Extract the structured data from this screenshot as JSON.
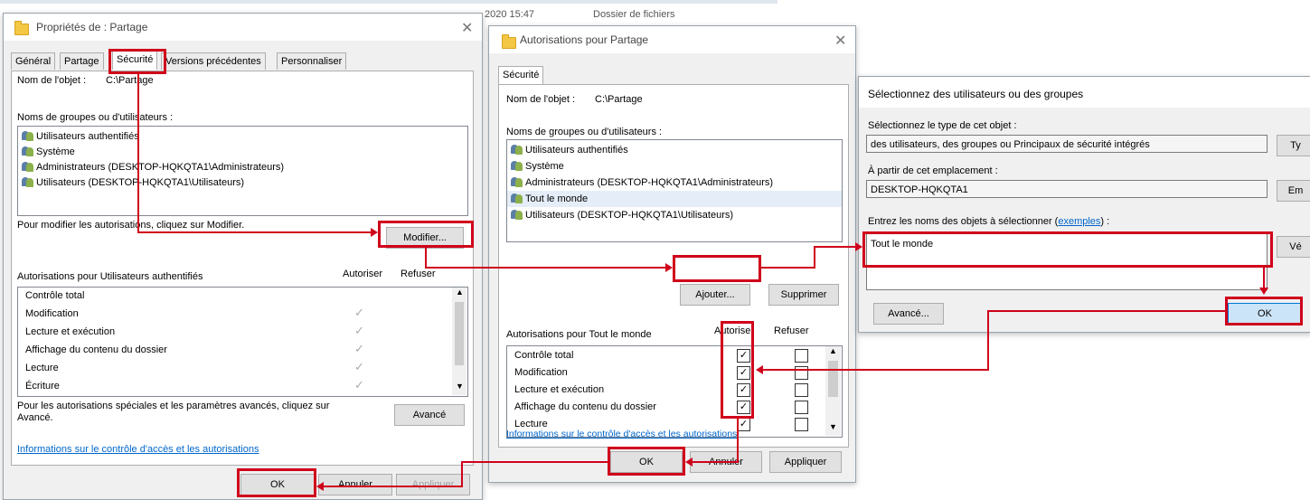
{
  "bg_header": {
    "date": "2020 15:47",
    "type": "Dossier de fichiers"
  },
  "win1": {
    "title": "Propriétés de : Partage",
    "tabs": [
      "Général",
      "Partage",
      "Sécurité",
      "Versions précédentes",
      "Personnaliser"
    ],
    "object_label": "Nom de l'objet :",
    "object_value": "C:\\Partage",
    "groups_label": "Noms de groupes ou d'utilisateurs :",
    "users": [
      "Utilisateurs authentifiés",
      "Système",
      "Administrateurs (DESKTOP-HQKQTA1\\Administrateurs)",
      "Utilisateurs (DESKTOP-HQKQTA1\\Utilisateurs)"
    ],
    "modify_hint": "Pour modifier les autorisations, cliquez sur Modifier.",
    "modify_button": "Modifier...",
    "perm_label": "Autorisations pour Utilisateurs authentifiés",
    "allow_col": "Autoriser",
    "deny_col": "Refuser",
    "perms": [
      "Contrôle total",
      "Modification",
      "Lecture et exécution",
      "Affichage du contenu du dossier",
      "Lecture",
      "Écriture"
    ],
    "special_text": "Pour les autorisations spéciales et les paramètres avancés, cliquez sur Avancé.",
    "advanced_button": "Avancé",
    "info_link": "Informations sur le contrôle d'accès et les autorisations",
    "ok": "OK",
    "cancel": "Annuler",
    "apply": "Appliquer"
  },
  "win2": {
    "title": "Autorisations pour Partage",
    "tab": "Sécurité",
    "object_label": "Nom de l'objet :",
    "object_value": "C:\\Partage",
    "groups_label": "Noms de groupes ou d'utilisateurs :",
    "users": [
      "Utilisateurs authentifiés",
      "Système",
      "Administrateurs (DESKTOP-HQKQTA1\\Administrateurs)",
      "Tout le monde",
      "Utilisateurs (DESKTOP-HQKQTA1\\Utilisateurs)"
    ],
    "add_button": "Ajouter...",
    "remove_button": "Supprimer",
    "perm_label": "Autorisations pour Tout le monde",
    "allow_col": "Autoriser",
    "deny_col": "Refuser",
    "perms": [
      "Contrôle total",
      "Modification",
      "Lecture et exécution",
      "Affichage du contenu du dossier",
      "Lecture"
    ],
    "info_link": "Informations sur le contrôle d'accès et les autorisations",
    "ok": "OK",
    "cancel": "Annuler",
    "apply": "Appliquer",
    "check_mark": "✓"
  },
  "win3": {
    "title": "Sélectionnez des utilisateurs ou des groupes",
    "type_label": "Sélectionnez le type de cet objet :",
    "type_value": "des utilisateurs, des groupes ou Principaux de sécurité intégrés",
    "type_button": "Ty",
    "location_label": "À partir de cet emplacement :",
    "location_value": "DESKTOP-HQKQTA1",
    "location_button": "Em",
    "names_label": "Entrez les noms des objets à sélectionner (exemples) :",
    "names_label_pre": "Entrez les noms des objets à sélectionner (",
    "names_link": "exemples",
    "names_label_post": ") :",
    "names_value": "Tout le monde",
    "verify_button": "Vé",
    "advanced_button": "Avancé...",
    "ok": "OK"
  },
  "colors": {
    "highlight": "#d0021b",
    "dialog_bg": "#f0f0f0",
    "link": "#0066cc"
  }
}
